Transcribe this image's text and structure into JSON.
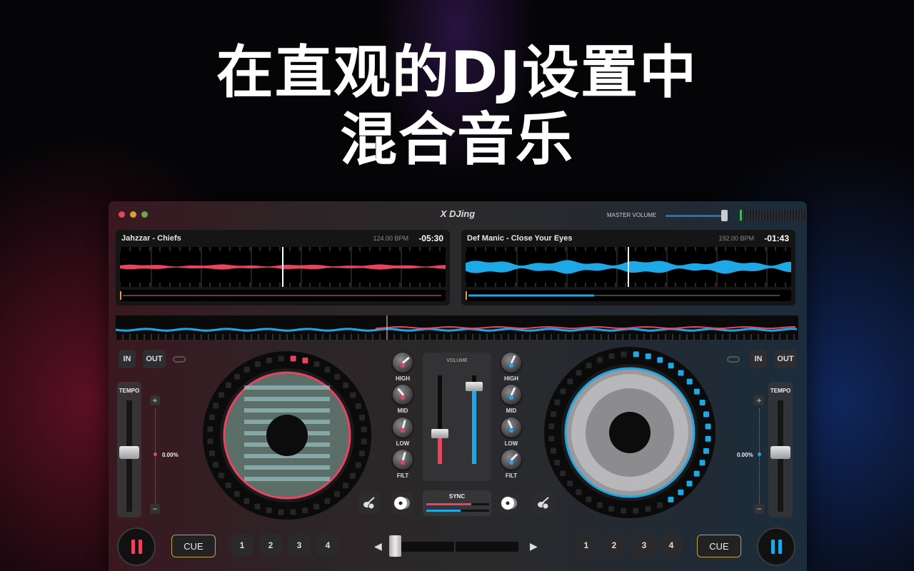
{
  "headline": {
    "line1": "在直观的DJ设置中",
    "line2": "混合音乐"
  },
  "window": {
    "title": "X DJing",
    "traffic_lights": {
      "close": "#e0475a",
      "minimize": "#d9a132",
      "zoom": "#6aa84f"
    },
    "master_volume": {
      "label": "MASTER VOLUME",
      "level": 0.95
    }
  },
  "decks": {
    "left": {
      "track": "Jahzzar - Chiefs",
      "bpm": "124.00 BPM",
      "time": "-05:30",
      "accent": "#e8435f",
      "loop_in": "IN",
      "loop_out": "OUT",
      "tempo_label": "TEMPO",
      "pitch": "0.00%",
      "plus": "+",
      "minus": "−",
      "cue": "CUE",
      "hotcues": [
        "1",
        "2",
        "3",
        "4"
      ],
      "play_state": "playing",
      "eq": {
        "high": "HIGH",
        "mid": "MID",
        "low": "LOW",
        "filt": "FILT"
      },
      "volume": 0.35
    },
    "right": {
      "track": "Def Manic - Close Your Eyes",
      "bpm": "192.00 BPM",
      "time": "-01:43",
      "accent": "#1fa8e6",
      "loop_in": "IN",
      "loop_out": "OUT",
      "tempo_label": "TEMPO",
      "pitch": "0.00%",
      "plus": "+",
      "minus": "−",
      "cue": "CUE",
      "hotcues": [
        "1",
        "2",
        "3",
        "4"
      ],
      "play_state": "playing",
      "eq": {
        "high": "HIGH",
        "mid": "MID",
        "low": "LOW",
        "filt": "FILT"
      },
      "volume": 0.88
    }
  },
  "mixer": {
    "volume_label": "VOLUME",
    "sync_label": "SYNC",
    "sync_left": 0.72,
    "sync_right": 0.55,
    "crossfader": 0.0,
    "icons": {
      "ai_left": "guitar-ai-icon",
      "vinyl_left": "vinyl-icon",
      "vinyl_right": "vinyl-icon",
      "ai_right": "guitar-ai-icon"
    }
  }
}
